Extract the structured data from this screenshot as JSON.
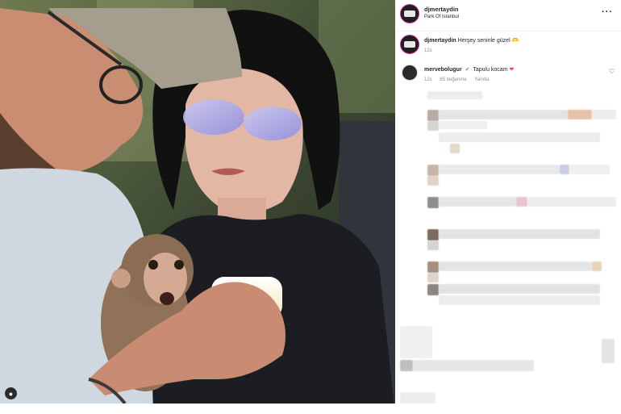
{
  "post": {
    "author": "djmertaydin",
    "location": "Park Of Istanbul",
    "more_icon": "more-horizontal-icon"
  },
  "caption": {
    "username": "djmertaydin",
    "text": "Herşey seninle güzel 🫶",
    "time": "12s"
  },
  "comment": {
    "username": "mervebolugur",
    "verified": "✔",
    "text": "Tapulu kocam",
    "heart": "❤",
    "time": "12s",
    "likes": "85 beğenme",
    "reply": "Yanıtla",
    "like_icon": "♡"
  },
  "photo": {
    "tag_icon": "user-tag-icon"
  },
  "colors": {
    "story_ring": "#d6249f",
    "verified": "#3897f0",
    "heart": "#ed4956"
  }
}
